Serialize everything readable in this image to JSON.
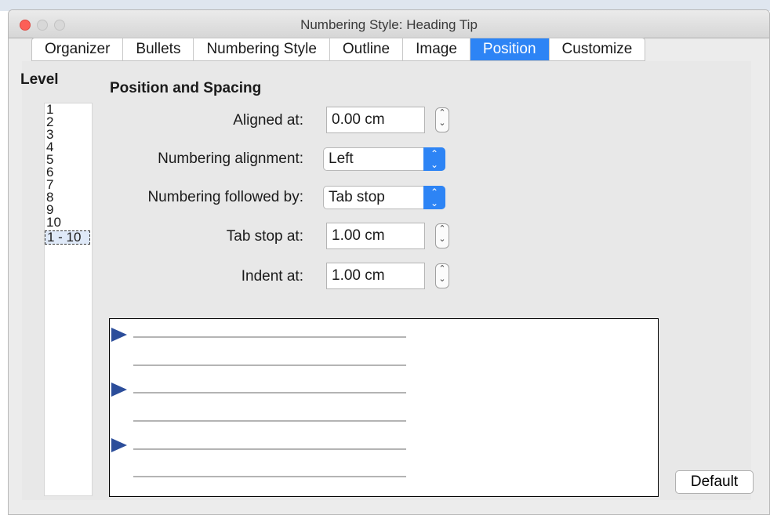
{
  "window": {
    "title": "Numbering Style: Heading Tip"
  },
  "tabs": [
    {
      "label": "Organizer",
      "active": false
    },
    {
      "label": "Bullets",
      "active": false
    },
    {
      "label": "Numbering Style",
      "active": false
    },
    {
      "label": "Outline",
      "active": false
    },
    {
      "label": "Image",
      "active": false
    },
    {
      "label": "Position",
      "active": true
    },
    {
      "label": "Customize",
      "active": false
    }
  ],
  "level": {
    "title": "Level",
    "items": [
      "1",
      "2",
      "3",
      "4",
      "5",
      "6",
      "7",
      "8",
      "9",
      "10",
      "1 - 10"
    ],
    "selected": "1 - 10"
  },
  "position": {
    "section_title": "Position and Spacing",
    "aligned_at": {
      "label": "Aligned at:",
      "value": "0.00 cm"
    },
    "numbering_alignment": {
      "label": "Numbering alignment:",
      "value": "Left"
    },
    "numbering_followed_by": {
      "label": "Numbering followed by:",
      "value": "Tab stop"
    },
    "tab_stop_at": {
      "label": "Tab stop at:",
      "value": "1.00 cm"
    },
    "indent_at": {
      "label": "Indent at:",
      "value": "1.00 cm"
    }
  },
  "buttons": {
    "default": "Default"
  },
  "colors": {
    "accent": "#2d84f5",
    "marker": "#2b4d9a",
    "close": "#fc5f57"
  }
}
